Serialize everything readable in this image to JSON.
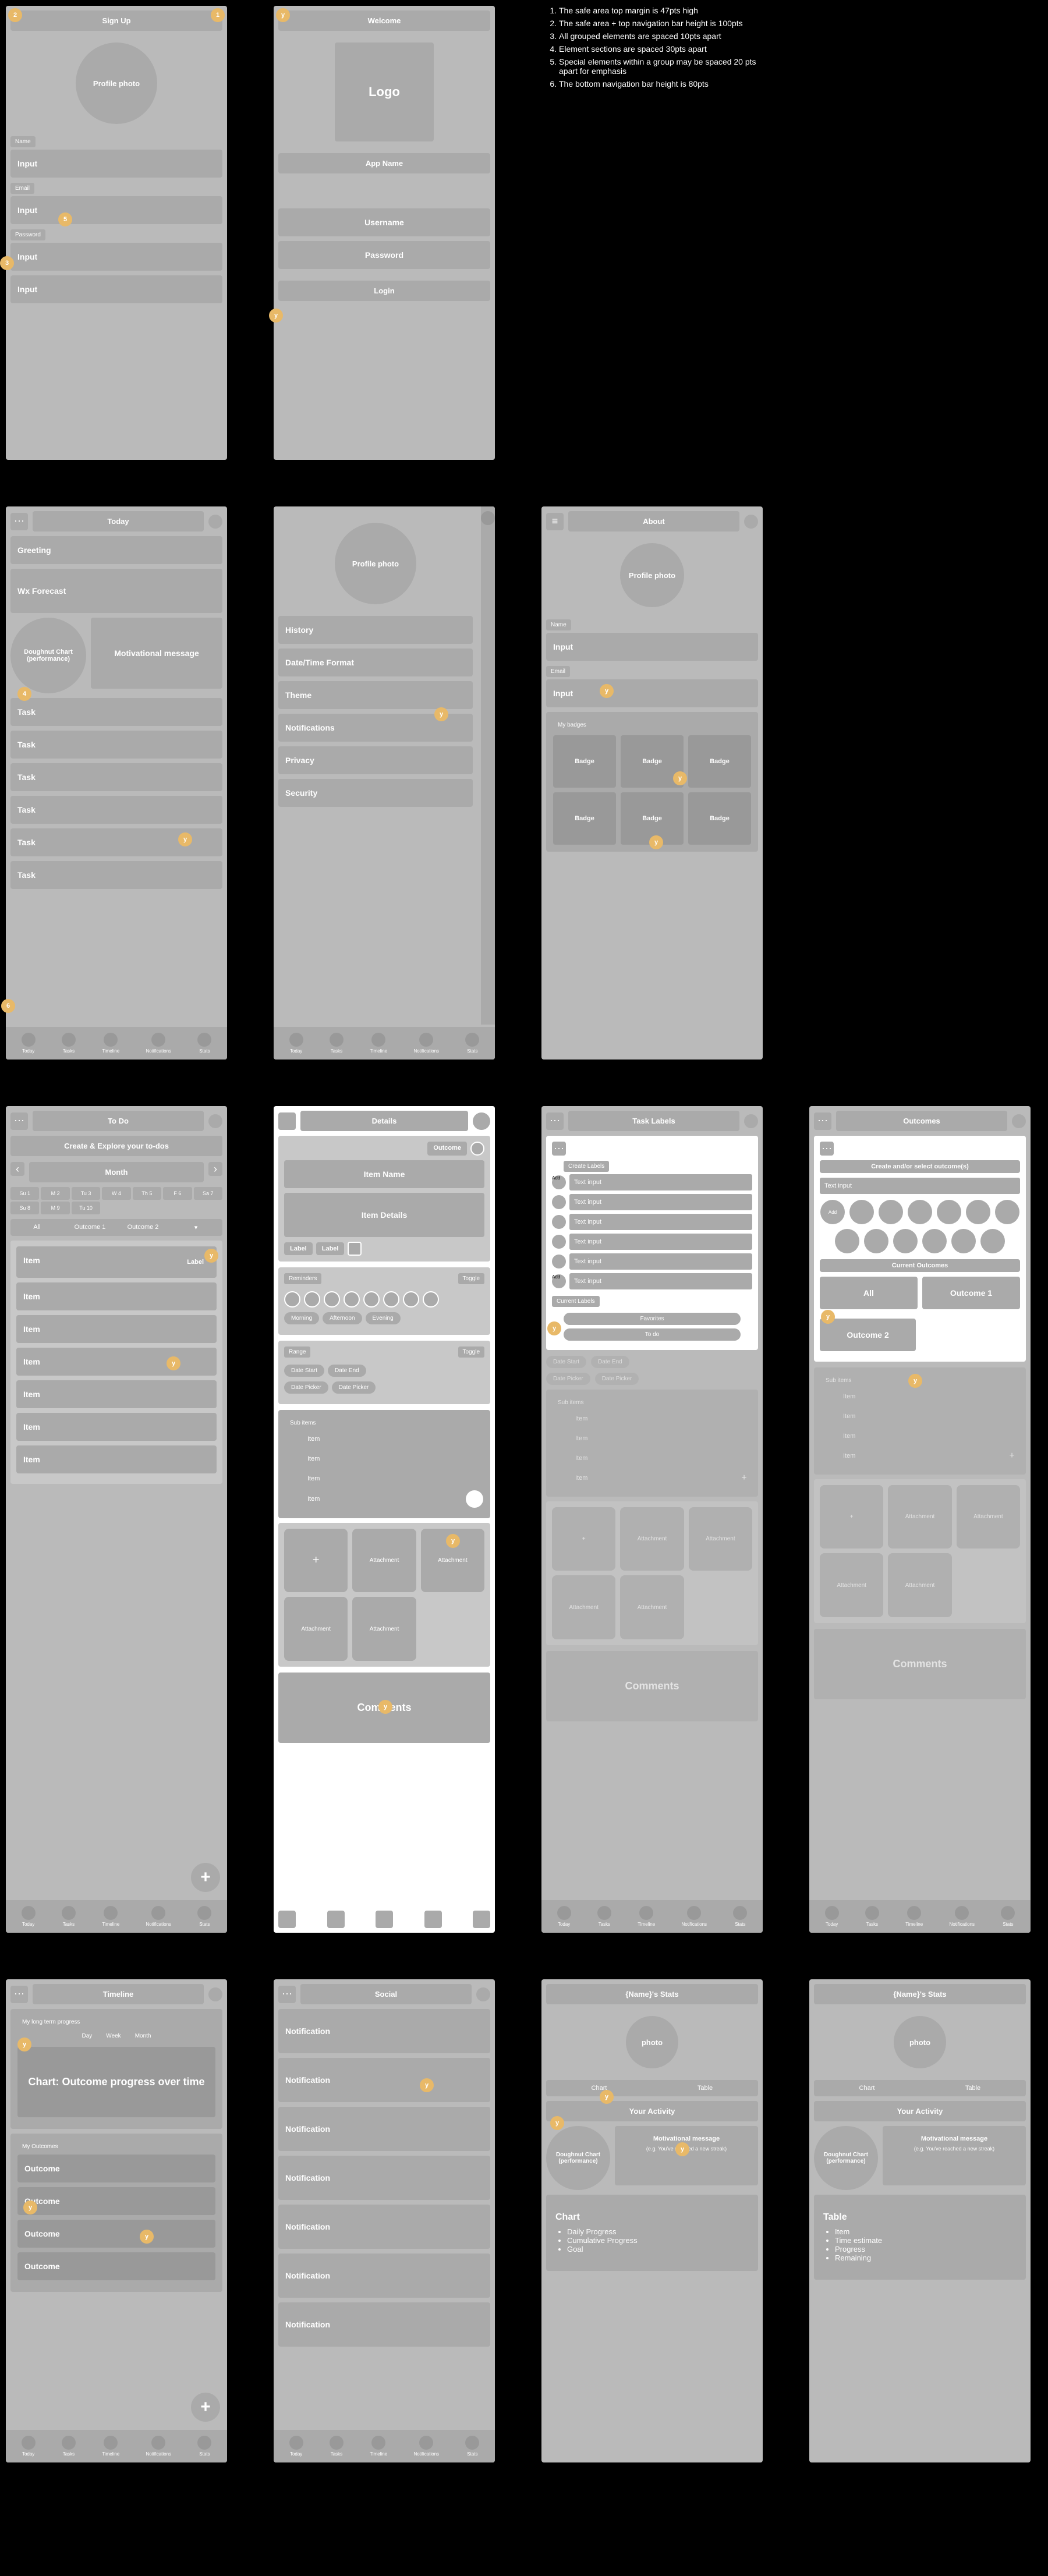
{
  "notes": [
    "The safe area top margin is 47pts high",
    "The safe area + top navigation bar height is 100pts",
    "All grouped elements are spaced 10pts apart",
    "Element sections are spaced 30pts apart",
    "Special elements within a group may be spaced 20 pts apart for emphasis",
    "The bottom navigation bar height is 80pts"
  ],
  "nav": {
    "today": "Today",
    "tasks": "Tasks",
    "timeline": "Timeline",
    "notifications": "Notifications",
    "stats": "Stats"
  },
  "signup": {
    "title": "Sign Up",
    "photo": "Profile photo",
    "name": "Name",
    "email": "Email",
    "password": "Password",
    "input": "Input"
  },
  "welcome": {
    "title": "Welcome",
    "logo": "Logo",
    "appname": "App Name",
    "user": "Username",
    "pass": "Password",
    "login": "Login"
  },
  "today": {
    "title": "Today",
    "greeting": "Greeting",
    "wx": "Wx Forecast",
    "chart": "Doughnut Chart (performance)",
    "msg": "Motivational message",
    "task": "Task"
  },
  "settings": {
    "items": [
      "History",
      "Date/Time Format",
      "Theme",
      "Notifications",
      "Privacy",
      "Security"
    ],
    "photo": "Profile photo"
  },
  "about": {
    "title": "About",
    "photo": "Profile photo",
    "name": "Name",
    "email": "Email",
    "input": "Input",
    "badges": "My badges",
    "badge": "Badge"
  },
  "todo": {
    "title": "To Do",
    "create": "Create & Explore your to-dos",
    "month": "Month",
    "days": [
      "Su 1",
      "M 2",
      "Tu 3",
      "W 4",
      "Th 5",
      "F 6",
      "Sa 7",
      "Su 8",
      "M 9",
      "Tu 10"
    ],
    "all": "All",
    "o1": "Outcome 1",
    "o2": "Outcome 2",
    "item": "Item",
    "label": "Label"
  },
  "details": {
    "title": "Details",
    "outcome": "Outcome",
    "name": "Item Name",
    "det": "Item Details",
    "label": "Label",
    "reminders": "Reminders",
    "toggle": "Toggle",
    "morning": "Morning",
    "afternoon": "Afternoon",
    "evening": "Evening",
    "range": "Range",
    "ds": "Date Start",
    "de": "Date End",
    "dp": "Date Picker",
    "sub": "Sub items",
    "item": "Item",
    "att": "Attachment",
    "comments": "Comments",
    "add": "+"
  },
  "labels": {
    "title": "Task Labels",
    "create": "Create Labels",
    "input": "Text input",
    "current": "Current Labels",
    "fav": "Favorites",
    "todo": "To do",
    "add": "Add",
    "sub": "Sub items",
    "item": "Item",
    "att": "Attachment",
    "comments": "Comments",
    "ds": "Date Start",
    "de": "Date End",
    "dp": "Date Picker"
  },
  "outcomes": {
    "title": "Outcomes",
    "create": "Create and/or select outcome(s)",
    "input": "Text input",
    "add": "Add",
    "current": "Current Outcomes",
    "all": "All",
    "o1": "Outcome 1",
    "o2": "Outcome 2",
    "sub": "Sub items",
    "item": "Item",
    "att": "Attachment",
    "comments": "Comments"
  },
  "timeline": {
    "title": "Timeline",
    "prog": "My long term progress",
    "day": "Day",
    "week": "Week",
    "month": "Month",
    "chart": "Chart: Outcome progress over time",
    "my": "My Outcomes",
    "outcome": "Outcome"
  },
  "social": {
    "title": "Social",
    "notif": "Notification"
  },
  "stats1": {
    "title": "{Name}'s Stats",
    "photo": "photo",
    "chart": "Chart",
    "table": "Table",
    "activity": "Your Activity",
    "dchart": "Doughnut Chart (performance)",
    "msg": "Motivational message",
    "eg": "(e.g. You've reached a new streak)",
    "h": "Chart",
    "items": [
      "Daily Progress",
      "Cumulative Progress",
      "Goal"
    ]
  },
  "stats2": {
    "title": "{Name}'s Stats",
    "h": "Table",
    "items": [
      "Item",
      "Time estimate",
      "Progress",
      "Remaining"
    ]
  }
}
